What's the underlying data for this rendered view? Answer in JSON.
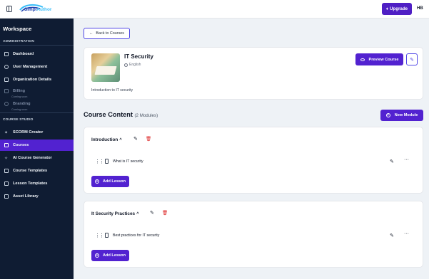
{
  "topbar": {
    "logo_text_part1": "Simpl",
    "logo_text_part2": "Author",
    "upgrade_label": "Upgrade",
    "user_initials": "HB"
  },
  "sidebar": {
    "workspace_title": "Workspace",
    "admin_section": "ADMINISTRATION",
    "studio_section": "COURSE STUDIO",
    "admin_items": [
      {
        "label": "Dashboard",
        "icon": "grid-icon"
      },
      {
        "label": "User Management",
        "icon": "users-icon"
      },
      {
        "label": "Organization Details",
        "icon": "document-icon"
      },
      {
        "label": "Billing",
        "icon": "card-icon",
        "note": "Coming soon",
        "disabled": true
      },
      {
        "label": "Branding",
        "icon": "palette-icon",
        "note": "Coming soon",
        "disabled": true
      }
    ],
    "studio_items": [
      {
        "label": "SCORM Creator",
        "icon": "sparkle-icon"
      },
      {
        "label": "Courses",
        "icon": "book-icon",
        "active": true
      },
      {
        "label": "AI Course Generator",
        "icon": "magic-icon"
      },
      {
        "label": "Course Templates",
        "icon": "template-icon"
      },
      {
        "label": "Lesson Templates",
        "icon": "layers-icon"
      },
      {
        "label": "Asset Library",
        "icon": "folder-icon"
      }
    ]
  },
  "main": {
    "back_label": "Back to Courses",
    "course": {
      "title": "IT Security",
      "language": "English",
      "description": "Introduction to IT security",
      "preview_label": "Preview Course"
    },
    "content_heading": "Course Content",
    "module_count": "(2 Modules)",
    "new_module_label": "New Module",
    "modules": [
      {
        "title": "Introduction",
        "lessons": [
          "What is IT security"
        ],
        "add_lesson_label": "Add Lesson"
      },
      {
        "title": "It Security Practices",
        "lessons": [
          "Best practices for IT security"
        ],
        "add_lesson_label": "Add Lesson"
      }
    ]
  },
  "colors": {
    "sidebar_bg": "#0f1c33",
    "accent": "#5222d0",
    "main_bg": "#eef2f6",
    "delete": "#dc2626"
  }
}
